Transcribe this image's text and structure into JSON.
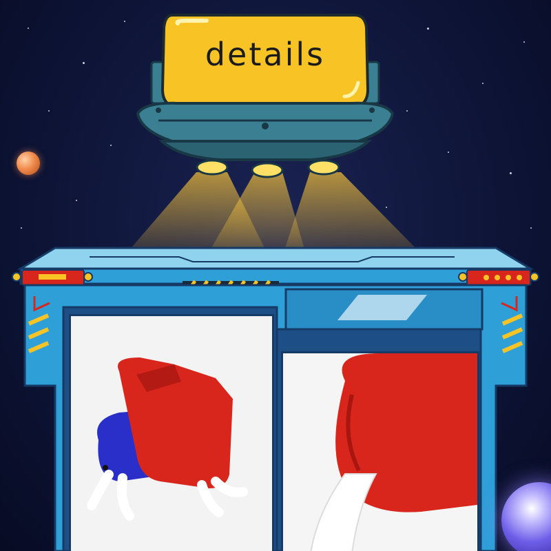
{
  "banner": {
    "title": "details"
  },
  "colors": {
    "background": "#0e1538",
    "banner_yellow": "#f7c325",
    "saucer_teal": "#3a7f92",
    "console_blue": "#2f9fd8",
    "panel_dark": "#153a66",
    "beam_yellow": "#f4c03a",
    "plush_red": "#d8261d",
    "plush_blue": "#2a2fc9"
  },
  "photos": [
    {
      "subject": "red-and-blue-capsule-plush-side-view"
    },
    {
      "subject": "red-capsule-plush-closeup"
    }
  ]
}
